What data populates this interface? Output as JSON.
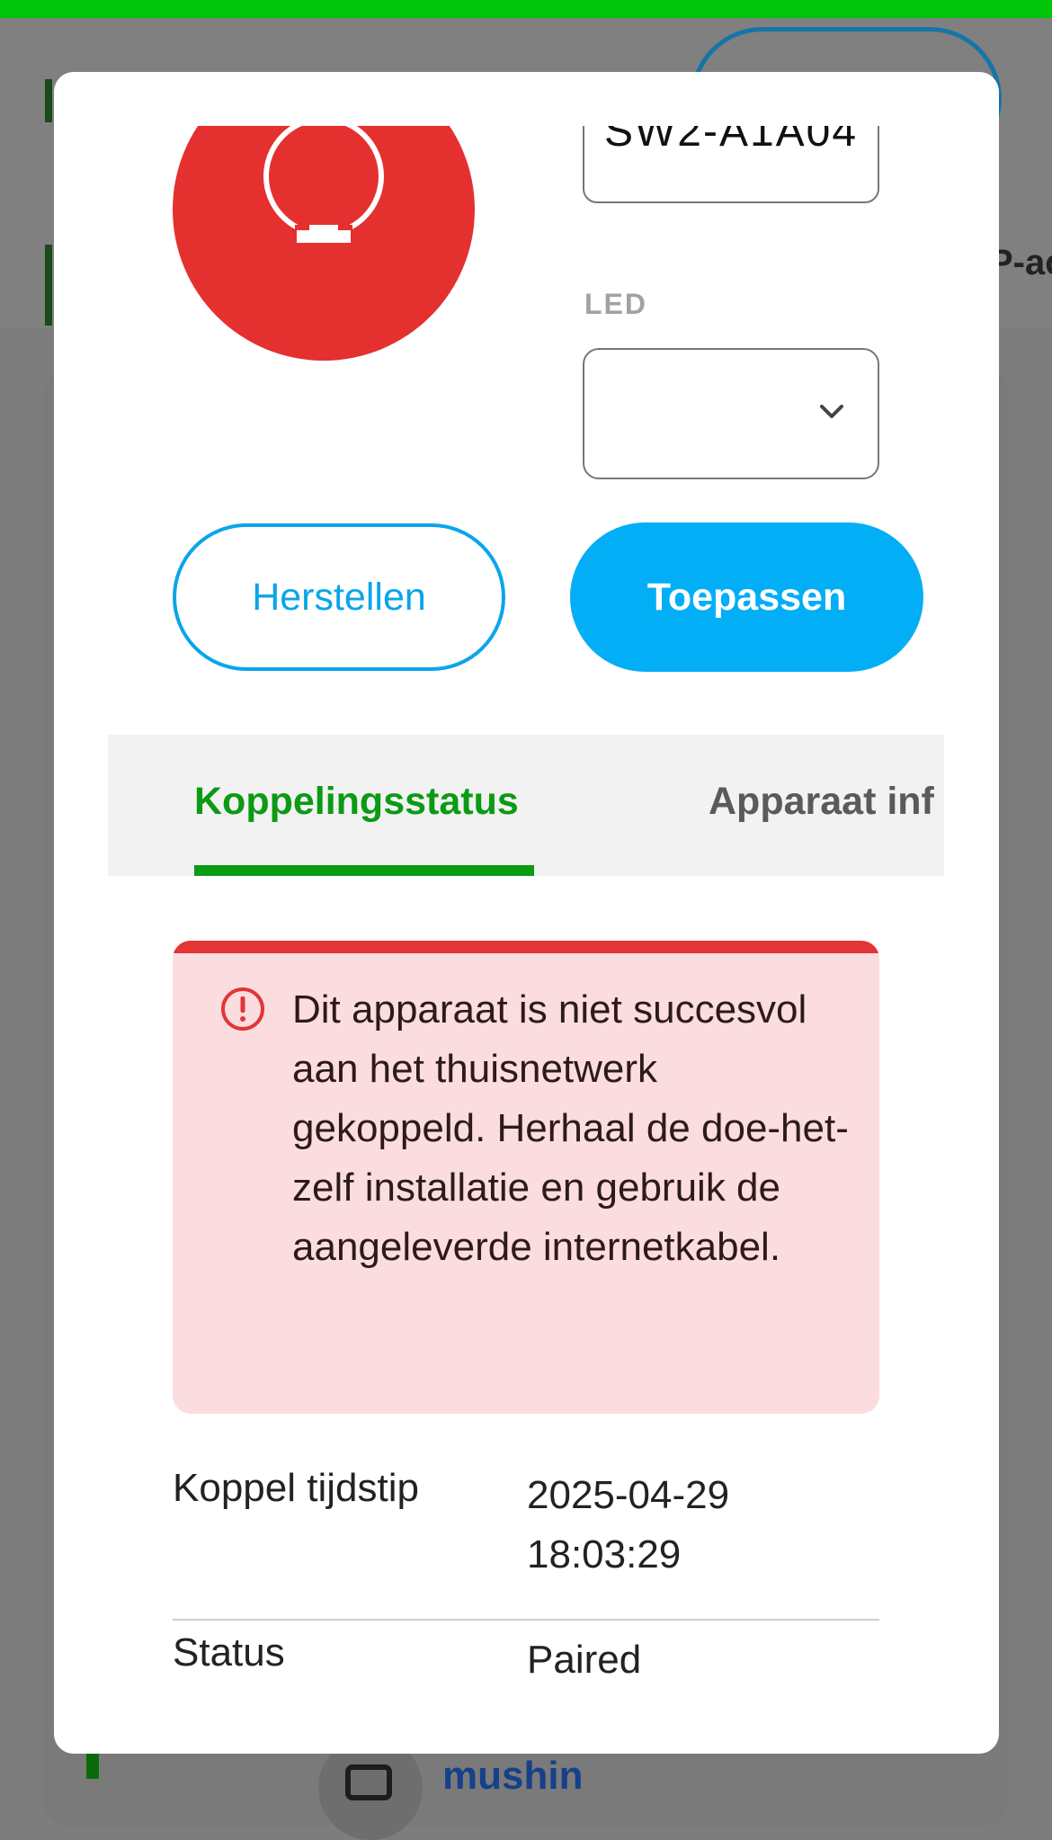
{
  "background": {
    "side_text": "P-ac",
    "link_text": "mushin"
  },
  "device": {
    "name": "SW2-A1A04",
    "led_label": "LED",
    "led_value": "",
    "status_color": "#e53030",
    "icon": "ring-light-icon"
  },
  "actions": {
    "reset_label": "Herstellen",
    "apply_label": "Toepassen"
  },
  "tabs": [
    {
      "label": "Koppelingsstatus",
      "active": true
    },
    {
      "label": "Apparaat inf",
      "active": false
    }
  ],
  "alert": {
    "icon": "alert-circle-icon",
    "message": "Dit apparaat is niet succesvol aan het thuisnetwerk gekoppeld. Herhaal de doe-het-zelf installatie en gebruik de aangeleverde internetkabel."
  },
  "pairing": {
    "time_label": "Koppel tijdstip",
    "time_date": "2025-04-29",
    "time_clock": "18:03:29",
    "status_label": "Status",
    "status_value": "Paired"
  },
  "colors": {
    "accent_green": "#0b9a14",
    "accent_blue": "#02aef6",
    "error_red": "#e33535",
    "error_bg": "#fbdde0"
  }
}
